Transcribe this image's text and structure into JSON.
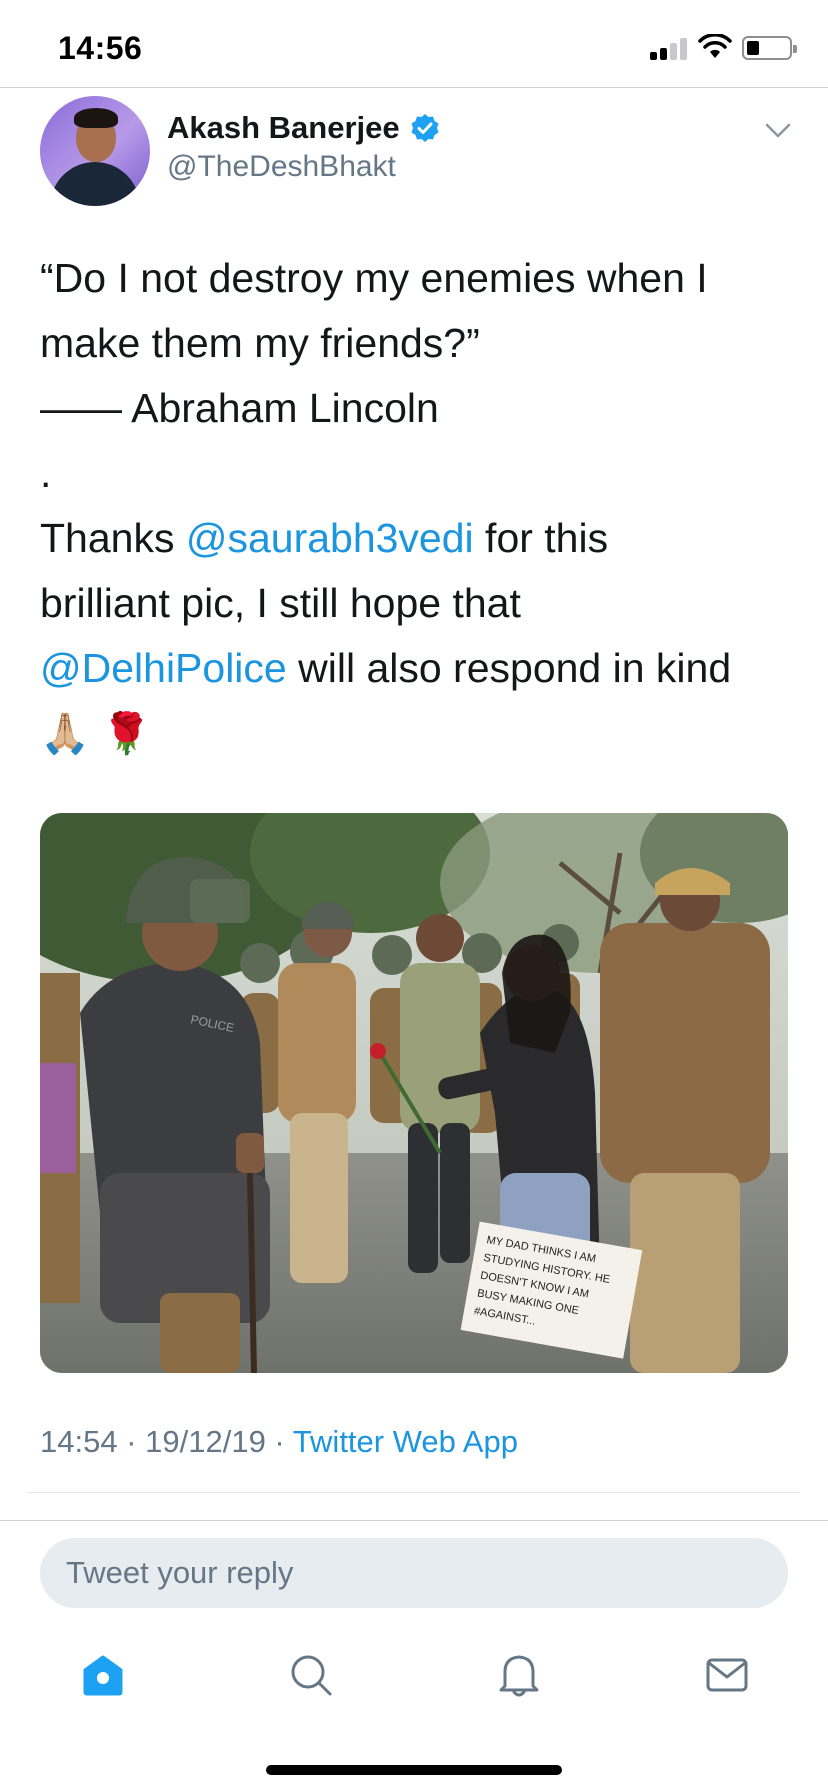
{
  "status_bar": {
    "time": "14:56",
    "icons": [
      "signal-icon",
      "wifi-icon",
      "battery-icon"
    ]
  },
  "tweet": {
    "author": {
      "name": "Akash Banerjee",
      "handle": "@TheDeshBhakt",
      "verified": true
    },
    "text": {
      "quote_line_1": "“Do I not destroy my enemies when I",
      "quote_line_2": "make them my friends?”",
      "attribution": "—— Abraham Lincoln",
      "separator": ".",
      "thanks_prefix": "Thanks ",
      "mention_1": "@saurabh3vedi",
      "thanks_suffix": " for this",
      "line_5": "brilliant pic, I still hope that",
      "mention_2": "@DelhiPolice",
      "line_6_suffix": " will also respond in kind",
      "emoji_1": "🙏🏼",
      "emoji_2": "🌹"
    },
    "photo": {
      "sign_text": [
        "MY DAD THINKS I AM",
        "STUDYING HISTORY. HE",
        "DOESN'T KNOW I AM",
        "BUSY MAKING ONE",
        "#AGAINST..."
      ],
      "vest_text": "POLICE"
    },
    "meta": {
      "time": "14:54",
      "dot_1": " · ",
      "date": "19/12/19",
      "dot_2": " · ",
      "source": "Twitter Web App"
    }
  },
  "reply": {
    "placeholder": "Tweet your reply"
  },
  "tab_bar": {
    "items": [
      "home-icon",
      "search-icon",
      "notifications-icon",
      "messages-icon"
    ],
    "active": "home-icon"
  },
  "colors": {
    "link": "#1b95e0",
    "secondary_text": "#657786",
    "verified": "#1da1f2",
    "input_bg": "#e6ecf0"
  }
}
